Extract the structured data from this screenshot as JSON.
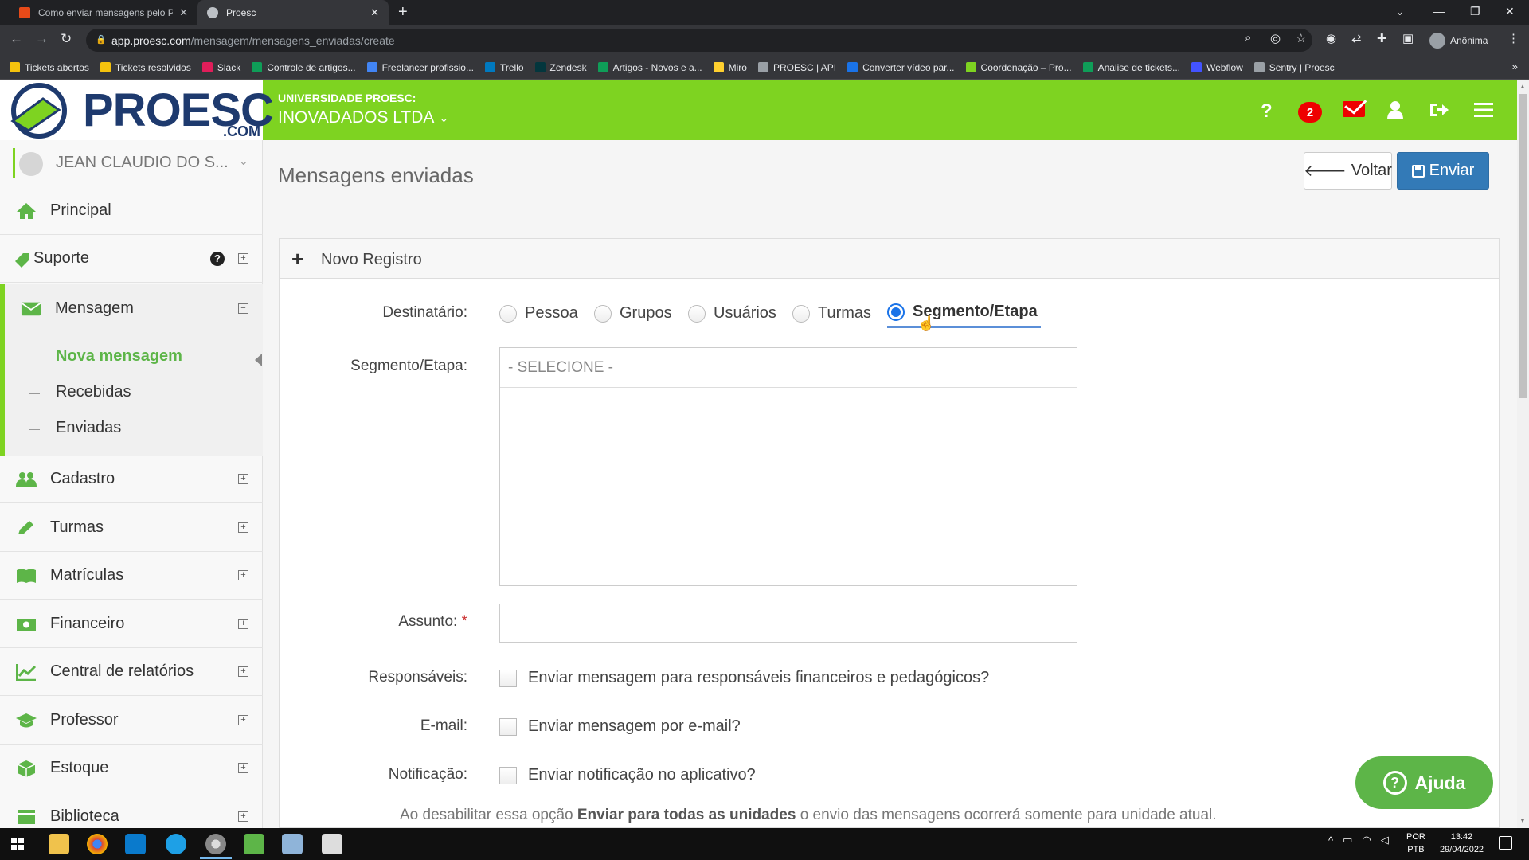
{
  "browser": {
    "tabs": [
      {
        "title": "Como enviar mensagens pelo Pr",
        "active": false
      },
      {
        "title": "Proesc",
        "active": true
      }
    ],
    "url_host": "app.proesc.com",
    "url_path": "/mensagem/mensagens_enviadas/create",
    "profile_label": "Anônima",
    "bookmarks": [
      {
        "label": "Tickets abertos",
        "color": "#f4c20d"
      },
      {
        "label": "Tickets resolvidos",
        "color": "#f4c20d"
      },
      {
        "label": "Slack",
        "color": "#e01e5a"
      },
      {
        "label": "Controle de artigos...",
        "color": "#0f9d58"
      },
      {
        "label": "Freelancer profissio...",
        "color": "#4285f4"
      },
      {
        "label": "Trello",
        "color": "#0079bf"
      },
      {
        "label": "Zendesk",
        "color": "#03363d"
      },
      {
        "label": "Artigos - Novos e a...",
        "color": "#0f9d58"
      },
      {
        "label": "Miro",
        "color": "#ffd02f"
      },
      {
        "label": "PROESC | API",
        "color": "#9aa0a6"
      },
      {
        "label": "Converter vídeo par...",
        "color": "#1a73e8"
      },
      {
        "label": "Coordenação – Pro...",
        "color": "#7ed321"
      },
      {
        "label": "Analise de tickets...",
        "color": "#0f9d58"
      },
      {
        "label": "Webflow",
        "color": "#4353ff"
      },
      {
        "label": "Sentry | Proesc",
        "color": "#9aa0a6"
      }
    ]
  },
  "header": {
    "logo_text": "PROESC",
    "logo_suffix": ".COM",
    "school_label": "UNIVERSIDADE PROESC:",
    "school_name": "INOVADADOS LTDA",
    "notif_count": "2",
    "brand_color": "#7ed321"
  },
  "sidebar": {
    "user_name": "JEAN CLAUDIO DO S...",
    "items": [
      {
        "label": "Principal",
        "icon": "home-icon",
        "expandable": false
      },
      {
        "label": "Suporte",
        "icon": "support-icon",
        "expandable": true
      },
      {
        "label": "Mensagem",
        "icon": "envelope-icon",
        "expandable": true,
        "expanded": true
      },
      {
        "label": "Cadastro",
        "icon": "users-icon",
        "expandable": true
      },
      {
        "label": "Turmas",
        "icon": "pencil-icon",
        "expandable": true
      },
      {
        "label": "Matrículas",
        "icon": "book-icon",
        "expandable": true
      },
      {
        "label": "Financeiro",
        "icon": "money-icon",
        "expandable": true
      },
      {
        "label": "Central de relatórios",
        "icon": "chart-icon",
        "expandable": true
      },
      {
        "label": "Professor",
        "icon": "graduation-cap-icon",
        "expandable": true
      },
      {
        "label": "Estoque",
        "icon": "box-icon",
        "expandable": true
      },
      {
        "label": "Biblioteca",
        "icon": "library-icon",
        "expandable": true
      }
    ],
    "mensagem_sub": [
      {
        "label": "Nova mensagem",
        "active": true
      },
      {
        "label": "Recebidas",
        "active": false
      },
      {
        "label": "Enviadas",
        "active": false
      }
    ]
  },
  "main": {
    "title": "Mensagens enviadas",
    "btn_voltar": "Voltar",
    "btn_enviar": "Enviar",
    "panel_title": "Novo Registro",
    "form": {
      "destinatario_label": "Destinatário:",
      "destinatario_options": [
        "Pessoa",
        "Grupos",
        "Usuários",
        "Turmas",
        "Segmento/Etapa"
      ],
      "destinatario_selected": "Segmento/Etapa",
      "segmento_label": "Segmento/Etapa:",
      "segmento_placeholder": "- SELECIONE -",
      "assunto_label": "Assunto:",
      "assunto_required": "*",
      "assunto_value": "",
      "responsaveis_label": "Responsáveis:",
      "responsaveis_text": "Enviar mensagem para responsáveis financeiros e pedagógicos?",
      "email_label": "E-mail:",
      "email_text": "Enviar mensagem por e-mail?",
      "notificacao_label": "Notificação:",
      "notificacao_text": "Enviar notificação no aplicativo?",
      "footnote_pre": "Ao desabilitar essa opção ",
      "footnote_bold": "Enviar para todas as unidades",
      "footnote_post": " o envio das mensagens ocorrerá somente para unidade atual."
    },
    "help_button": "Ajuda"
  },
  "taskbar": {
    "lang_top": "POR",
    "lang_bottom": "PTB",
    "time": "13:42",
    "date": "29/04/2022"
  }
}
